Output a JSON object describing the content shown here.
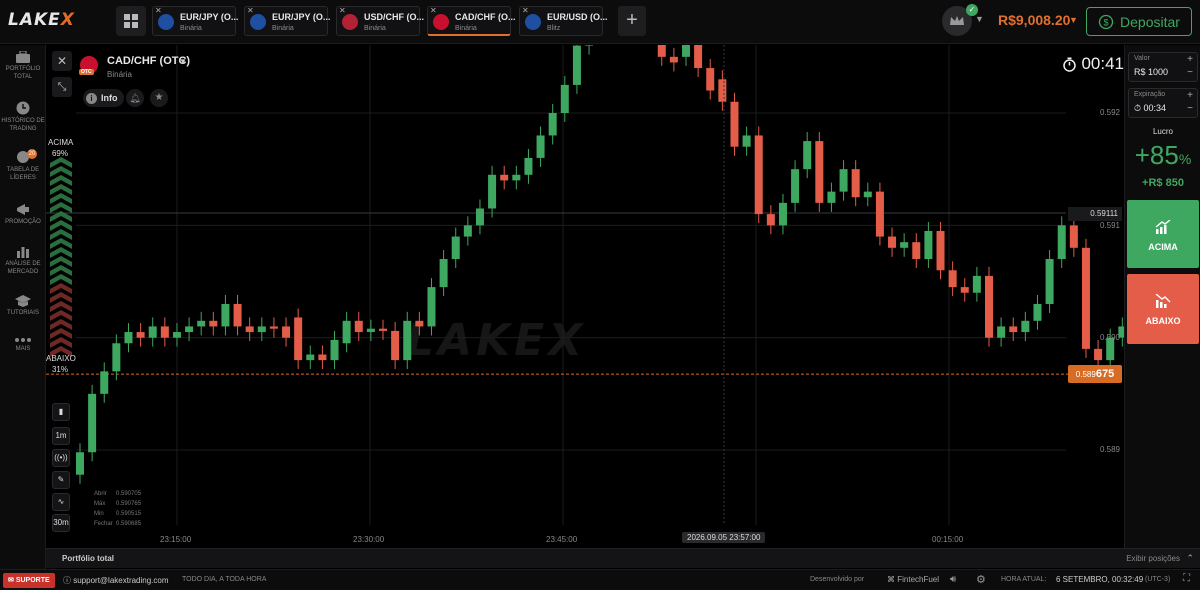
{
  "app": {
    "logo_text": "LAKE",
    "logo_x": "X"
  },
  "tabs": [
    {
      "name": "EUR/JPY (O...",
      "type": "Binária",
      "flag": "#1f4fa0"
    },
    {
      "name": "EUR/JPY (O...",
      "type": "Binária",
      "flag": "#1f4fa0"
    },
    {
      "name": "USD/CHF (O...",
      "type": "Binária",
      "flag": "#b22234"
    },
    {
      "name": "CAD/CHF (O...",
      "type": "Binária",
      "flag": "#c8102e"
    },
    {
      "name": "EUR/USD (O...",
      "type": "Blitz",
      "flag": "#1f4fa0"
    }
  ],
  "account": {
    "balance": "R$9,008.20",
    "deposit_label": "Depositar"
  },
  "sidebar": [
    {
      "label": "PORTFÓLIO TOTAL",
      "icon": "briefcase-icon"
    },
    {
      "label": "HISTÓRICO DE TRADING",
      "icon": "clock-icon"
    },
    {
      "label": "TABELA DE LÍDERES",
      "icon": "chat-icon",
      "badge": "20"
    },
    {
      "label": "PROMOÇÃO",
      "icon": "megaphone-icon"
    },
    {
      "label": "ANÁLISE DE MERCADO",
      "icon": "chart-icon"
    },
    {
      "label": "TUTORIAIS",
      "icon": "graduation-icon"
    },
    {
      "label": "MAIS",
      "icon": "more-icon"
    }
  ],
  "asset": {
    "name": "CAD/CHF (OTC)",
    "type": "Binária",
    "otc_badge": "OTC",
    "info_label": "Info",
    "timer": "00:41"
  },
  "sentiment": {
    "up_label": "ACIMA",
    "up_pct": "69%",
    "down_label": "ABAIXO",
    "down_pct": "31%"
  },
  "tools": {
    "timeframe": "1m",
    "interval": "30m"
  },
  "ohlc": {
    "open_label": "Abrir",
    "open": "0.590705",
    "max_label": "Máx",
    "max": "0.590765",
    "min_label": "Min",
    "min": "0.590515",
    "close_label": "Fechar",
    "close": "0.590685"
  },
  "price_axis": {
    "ticks": [
      "0.592",
      "0.591",
      "0.590",
      "0.589"
    ],
    "high_marker": "0.59111",
    "current_prefix": "0.589",
    "current_suffix": "675"
  },
  "time_axis": {
    "ticks": [
      "23:15:00",
      "23:30:00",
      "23:45:00",
      "00:15:00"
    ],
    "crosshair_time": "2026.09.05 23:57:00"
  },
  "trade_panel": {
    "amount_caption": "Valor",
    "amount_value": "R$ 1000",
    "expiry_caption": "Expiração",
    "expiry_value": "00:34",
    "profit_label": "Lucro",
    "profit_pct": "+85",
    "profit_pct_unit": "%",
    "profit_value": "+R$ 850",
    "up_button": "ACIMA",
    "down_button": "ABAIXO"
  },
  "portfolio": {
    "title": "Portfólio total",
    "link": "Exibir posições"
  },
  "footer": {
    "support_label": "SUPORTE",
    "email": "support@lakextrading.com",
    "hours": "TODO DIA, A TODA HORA",
    "developed_by": "Desenvolvido por",
    "developer": "FintechFuel",
    "time_label": "HORA ATUAL:",
    "time_value": "6 SETEMBRO, 00:32:49",
    "timezone": "(UTC-3)"
  },
  "colors": {
    "up": "#3fa860",
    "down": "#e35d49",
    "accent": "#e0702e",
    "bg": "#000000"
  },
  "chart_data": {
    "type": "candlestick",
    "price_range": [
      0.5888,
      0.5923
    ],
    "price_ticks": [
      0.592,
      0.591,
      0.59,
      0.589
    ],
    "high_line": 0.59111,
    "current_price": 0.589675,
    "candles": [
      [
        0.58878,
        0.58898
      ],
      [
        0.58898,
        0.5895
      ],
      [
        0.5895,
        0.5897
      ],
      [
        0.5897,
        0.58995
      ],
      [
        0.58995,
        0.59005
      ],
      [
        0.59005,
        0.59
      ],
      [
        0.59,
        0.5901
      ],
      [
        0.5901,
        0.59
      ],
      [
        0.59,
        0.59005
      ],
      [
        0.59005,
        0.5901
      ],
      [
        0.5901,
        0.59015
      ],
      [
        0.59015,
        0.5901
      ],
      [
        0.5901,
        0.5903
      ],
      [
        0.5903,
        0.5901
      ],
      [
        0.5901,
        0.59005
      ],
      [
        0.59005,
        0.5901
      ],
      [
        0.5901,
        0.59008
      ],
      [
        0.5901,
        0.59
      ],
      [
        0.59018,
        0.5898
      ],
      [
        0.5898,
        0.58985
      ],
      [
        0.58985,
        0.5898
      ],
      [
        0.5898,
        0.58998
      ],
      [
        0.58995,
        0.59015
      ],
      [
        0.59015,
        0.59005
      ],
      [
        0.59005,
        0.59008
      ],
      [
        0.59008,
        0.59006
      ],
      [
        0.59006,
        0.5898
      ],
      [
        0.5898,
        0.59015
      ],
      [
        0.59015,
        0.5901
      ],
      [
        0.5901,
        0.59045
      ],
      [
        0.59045,
        0.5907
      ],
      [
        0.5907,
        0.5909
      ],
      [
        0.5909,
        0.591
      ],
      [
        0.591,
        0.59115
      ],
      [
        0.59115,
        0.59145
      ],
      [
        0.59145,
        0.5914
      ],
      [
        0.5914,
        0.59145
      ],
      [
        0.59145,
        0.5916
      ],
      [
        0.5916,
        0.5918
      ],
      [
        0.5918,
        0.592
      ],
      [
        0.592,
        0.59225
      ],
      [
        0.59225,
        0.5926
      ],
      [
        0.5926,
        0.5929
      ],
      [
        0.5929,
        0.59315
      ],
      [
        0.59315,
        0.59345
      ],
      [
        0.59345,
        0.59365
      ],
      [
        0.59365,
        0.59375
      ],
      [
        0.59375,
        0.59365
      ],
      [
        0.5936,
        0.5925
      ],
      [
        0.5925,
        0.59245
      ],
      [
        0.5925,
        0.5928
      ],
      [
        0.5928,
        0.5924
      ],
      [
        0.5924,
        0.5922
      ],
      [
        0.5923,
        0.5921
      ],
      [
        0.5921,
        0.5917
      ],
      [
        0.5917,
        0.5918
      ],
      [
        0.5918,
        0.5911
      ],
      [
        0.5911,
        0.591
      ],
      [
        0.591,
        0.5912
      ],
      [
        0.5912,
        0.5915
      ],
      [
        0.5915,
        0.59175
      ],
      [
        0.59175,
        0.5912
      ],
      [
        0.5912,
        0.5913
      ],
      [
        0.5913,
        0.5915
      ],
      [
        0.5915,
        0.59125
      ],
      [
        0.59125,
        0.5913
      ],
      [
        0.5913,
        0.5909
      ],
      [
        0.5909,
        0.5908
      ],
      [
        0.5908,
        0.59085
      ],
      [
        0.59085,
        0.5907
      ],
      [
        0.5907,
        0.59095
      ],
      [
        0.59095,
        0.5906
      ],
      [
        0.5906,
        0.59045
      ],
      [
        0.59045,
        0.5904
      ],
      [
        0.5904,
        0.59055
      ],
      [
        0.59055,
        0.59
      ],
      [
        0.59,
        0.5901
      ],
      [
        0.5901,
        0.59005
      ],
      [
        0.59005,
        0.59015
      ],
      [
        0.59015,
        0.5903
      ],
      [
        0.5903,
        0.5907
      ],
      [
        0.5907,
        0.591
      ],
      [
        0.591,
        0.5908
      ],
      [
        0.5908,
        0.5899
      ],
      [
        0.5899,
        0.5898
      ],
      [
        0.5898,
        0.59
      ],
      [
        0.59,
        0.5901
      ],
      [
        0.5901,
        0.59
      ],
      [
        0.59,
        0.59015
      ]
    ]
  }
}
